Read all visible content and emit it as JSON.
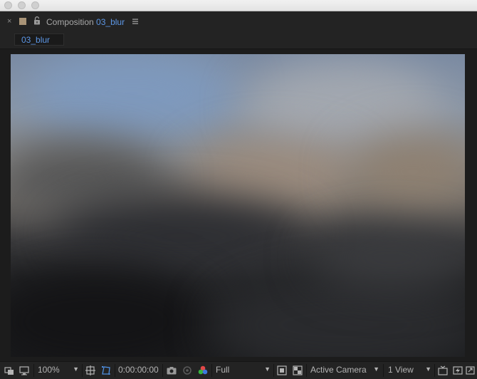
{
  "panel": {
    "close_glyph": "×",
    "title_prefix": "Composition",
    "composition_name": "03_blur",
    "label_color": "#a99477",
    "accent_color": "#5d97e6"
  },
  "tab": {
    "label": "03_blur"
  },
  "toolbar": {
    "zoom": "100%",
    "timecode": "0:00:00:00",
    "resolution": "Full",
    "camera": "Active Camera",
    "views": "1 View"
  },
  "icons": {
    "close": "close-icon",
    "label_swatch": "label-color-swatch",
    "lock": "lock-icon",
    "menu": "hamburger-menu-icon",
    "always_preview": "always-preview-icon",
    "monitor": "monitor-output-icon",
    "region": "region-of-interest-icon",
    "transparency": "toggle-transparency-grid-icon",
    "snapshot": "camera-snapshot-icon",
    "show_snapshot": "show-snapshot-icon",
    "color_channels": "rgb-channels-icon",
    "fast_previews": "fast-previews-icon",
    "checkerboard": "transparency-checkerboard-icon",
    "flowchart": "flowchart-icon",
    "reset_exposure": "reset-exposure-icon",
    "toggle_pixel": "toggle-pixel-aspect-icon"
  }
}
